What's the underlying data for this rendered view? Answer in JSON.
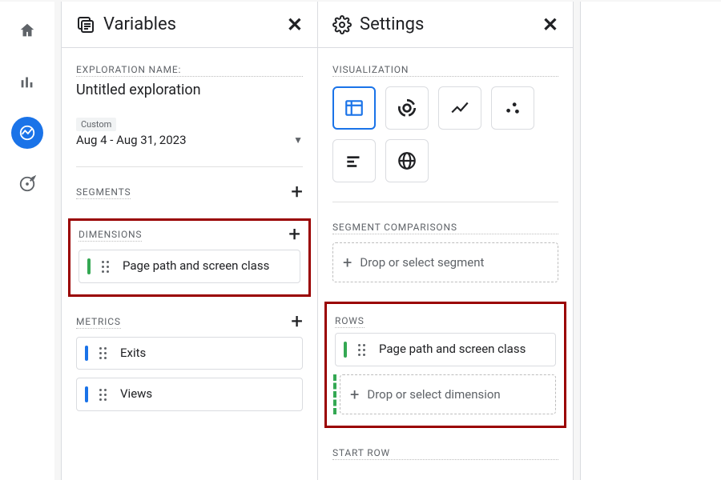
{
  "rail": {
    "items": [
      "home-icon",
      "reports-icon",
      "explore-icon",
      "target-icon"
    ],
    "activeIndex": 2
  },
  "variables": {
    "title": "Variables",
    "explorationLabel": "EXPLORATION NAME:",
    "explorationValue": "Untitled exploration",
    "dateBadge": "Custom",
    "dateRange": "Aug 4 - Aug 31, 2023",
    "segmentsLabel": "SEGMENTS",
    "dimensionsLabel": "DIMENSIONS",
    "dimensionChip": "Page path and screen class",
    "metricsLabel": "METRICS",
    "metrics": [
      "Exits",
      "Views"
    ]
  },
  "settings": {
    "title": "Settings",
    "visualizationLabel": "VISUALIZATION",
    "vizOptions": [
      "table",
      "donut",
      "line",
      "scatter",
      "bar",
      "geo"
    ],
    "segmentComparisonsLabel": "SEGMENT COMPARISONS",
    "segmentDrop": "Drop or select segment",
    "rowsLabel": "ROWS",
    "rowsChip": "Page path and screen class",
    "rowsDrop": "Drop or select dimension",
    "startRowLabel": "START ROW"
  }
}
